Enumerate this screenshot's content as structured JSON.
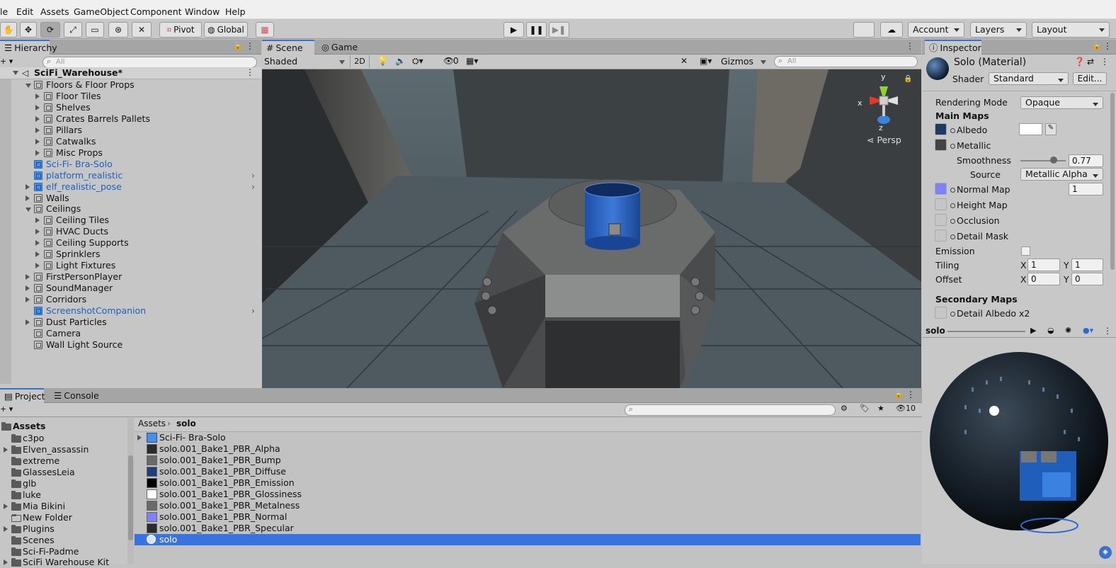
{
  "menu": [
    "le",
    "Edit",
    "Assets",
    "GameObject",
    "Component",
    "Window",
    "Help"
  ],
  "toolbar": {
    "pivot": "Pivot",
    "global": "Global",
    "account": "Account",
    "layers": "Layers",
    "layout": "Layout"
  },
  "hierarchy": {
    "tab": "Hierarchy",
    "search_placeholder": "All",
    "scene": "SciFi_Warehouse*",
    "items": [
      {
        "label": "Floors & Floor Props",
        "indent": 1,
        "exp": "d",
        "blue": false,
        "arrow": false
      },
      {
        "label": "Floor Tiles",
        "indent": 2,
        "exp": "r",
        "blue": false,
        "arrow": false
      },
      {
        "label": "Shelves",
        "indent": 2,
        "exp": "r",
        "blue": false,
        "arrow": false
      },
      {
        "label": "Crates Barrels Pallets",
        "indent": 2,
        "exp": "r",
        "blue": false,
        "arrow": false
      },
      {
        "label": "Pillars",
        "indent": 2,
        "exp": "r",
        "blue": false,
        "arrow": false
      },
      {
        "label": "Catwalks",
        "indent": 2,
        "exp": "r",
        "blue": false,
        "arrow": false
      },
      {
        "label": "Misc Props",
        "indent": 2,
        "exp": "r",
        "blue": false,
        "arrow": false
      },
      {
        "label": "Sci-Fi- Bra-Solo",
        "indent": 1,
        "exp": "",
        "blue": true,
        "arrow": false
      },
      {
        "label": "platform_realistic",
        "indent": 1,
        "exp": "",
        "blue": true,
        "arrow": true
      },
      {
        "label": "elf_realistic_pose",
        "indent": 1,
        "exp": "r",
        "blue": true,
        "arrow": true
      },
      {
        "label": "Walls",
        "indent": 1,
        "exp": "r",
        "blue": false,
        "arrow": false
      },
      {
        "label": "Ceilings",
        "indent": 1,
        "exp": "d",
        "blue": false,
        "arrow": false
      },
      {
        "label": "Ceiling Tiles",
        "indent": 2,
        "exp": "r",
        "blue": false,
        "arrow": false
      },
      {
        "label": "HVAC Ducts",
        "indent": 2,
        "exp": "r",
        "blue": false,
        "arrow": false
      },
      {
        "label": "Ceiling Supports",
        "indent": 2,
        "exp": "r",
        "blue": false,
        "arrow": false
      },
      {
        "label": "Sprinklers",
        "indent": 2,
        "exp": "r",
        "blue": false,
        "arrow": false
      },
      {
        "label": "Light Fixtures",
        "indent": 2,
        "exp": "r",
        "blue": false,
        "arrow": false
      },
      {
        "label": "FirstPersonPlayer",
        "indent": 1,
        "exp": "r",
        "blue": false,
        "arrow": false
      },
      {
        "label": "SoundManager",
        "indent": 1,
        "exp": "r",
        "blue": false,
        "arrow": false
      },
      {
        "label": "Corridors",
        "indent": 1,
        "exp": "r",
        "blue": false,
        "arrow": false
      },
      {
        "label": "ScreenshotCompanion",
        "indent": 1,
        "exp": "",
        "blue": true,
        "arrow": true
      },
      {
        "label": "Dust Particles",
        "indent": 1,
        "exp": "r",
        "blue": false,
        "arrow": false
      },
      {
        "label": "Camera",
        "indent": 1,
        "exp": "",
        "blue": false,
        "arrow": false
      },
      {
        "label": "Wall Light Source",
        "indent": 1,
        "exp": "",
        "blue": false,
        "arrow": false
      }
    ]
  },
  "scene": {
    "tab_scene": "Scene",
    "tab_game": "Game",
    "shading": "Shaded",
    "mode_2d": "2D",
    "hidden_count": "0",
    "gizmos": "Gizmos",
    "search_placeholder": "All",
    "axis_x": "x",
    "axis_y": "y",
    "axis_z": "z",
    "persp": "Persp"
  },
  "inspector": {
    "tab": "Inspector",
    "title": "Solo (Material)",
    "shader_label": "Shader",
    "shader_value": "Standard",
    "edit_button": "Edit...",
    "rendering_mode_label": "Rendering Mode",
    "rendering_mode_value": "Opaque",
    "main_maps": "Main Maps",
    "albedo": "Albedo",
    "metallic": "Metallic",
    "smoothness_label": "Smoothness",
    "smoothness_value": "0.77",
    "smoothness_fraction": 0.77,
    "source_label": "Source",
    "source_value": "Metallic Alpha",
    "normal_map": "Normal Map",
    "normal_value": "1",
    "height_map": "Height Map",
    "occlusion": "Occlusion",
    "detail_mask": "Detail Mask",
    "emission": "Emission",
    "tiling": "Tiling",
    "tiling_x": "1",
    "tiling_y": "1",
    "offset": "Offset",
    "offset_x": "0",
    "offset_y": "0",
    "x": "X",
    "y": "Y",
    "secondary_maps": "Secondary Maps",
    "detail_albedo": "Detail Albedo x2",
    "preview_name": "solo"
  },
  "project": {
    "tab_project": "Project",
    "tab_console": "Console",
    "hidden_count": "10",
    "breadcrumb_root": "Assets",
    "breadcrumb_current": "solo",
    "tree_root": "Assets",
    "folders": [
      {
        "label": "c3po",
        "exp": false
      },
      {
        "label": "Elven_assassin",
        "exp": true
      },
      {
        "label": "extreme",
        "exp": false
      },
      {
        "label": "GlassesLeia",
        "exp": false
      },
      {
        "label": "glb",
        "exp": false
      },
      {
        "label": "luke",
        "exp": false
      },
      {
        "label": "Mia Bikini",
        "exp": true
      },
      {
        "label": "New Folder",
        "exp": false,
        "empty": true
      },
      {
        "label": "Plugins",
        "exp": true
      },
      {
        "label": "Scenes",
        "exp": false
      },
      {
        "label": "Sci-Fi-Padme",
        "exp": false
      },
      {
        "label": "SciFi Warehouse Kit",
        "exp": true
      }
    ],
    "files": [
      {
        "label": "Sci-Fi- Bra-Solo",
        "kind": "prefab"
      },
      {
        "label": "solo.001_Bake1_PBR_Alpha",
        "kind": "tex-dark"
      },
      {
        "label": "solo.001_Bake1_PBR_Bump",
        "kind": "tex-gray"
      },
      {
        "label": "solo.001_Bake1_PBR_Diffuse",
        "kind": "tex-blue"
      },
      {
        "label": "solo.001_Bake1_PBR_Emission",
        "kind": "tex-black"
      },
      {
        "label": "solo.001_Bake1_PBR_Glossiness",
        "kind": "tex-white"
      },
      {
        "label": "solo.001_Bake1_PBR_Metalness",
        "kind": "tex-gray"
      },
      {
        "label": "solo.001_Bake1_PBR_Normal",
        "kind": "tex-normal"
      },
      {
        "label": "solo.001_Bake1_PBR_Specular",
        "kind": "tex-dark"
      },
      {
        "label": "solo",
        "kind": "material",
        "selected": true
      }
    ]
  },
  "colors": {
    "selection": "#3a72e0",
    "accent": "#3a72c9"
  }
}
